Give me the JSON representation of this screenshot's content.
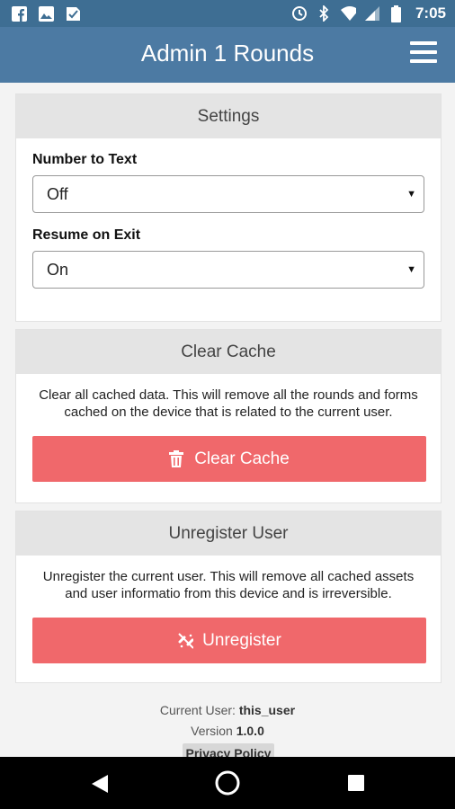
{
  "status_bar": {
    "time": "7:05",
    "icons": [
      "facebook-icon",
      "image-icon",
      "check-icon",
      "sync-icon",
      "bluetooth-icon",
      "wifi-icon",
      "signal-icon",
      "battery-icon"
    ]
  },
  "app_bar": {
    "title": "Admin 1 Rounds",
    "menu_icon": "hamburger-icon"
  },
  "settings": {
    "header": "Settings",
    "number_to_text": {
      "label": "Number to Text",
      "value": "Off"
    },
    "resume_on_exit": {
      "label": "Resume on Exit",
      "value": "On"
    }
  },
  "clear_cache": {
    "header": "Clear Cache",
    "description": "Clear all cached data. This will remove all the rounds and forms cached on the device that is related to the current user.",
    "button_label": "Clear Cache",
    "button_icon": "trash-icon"
  },
  "unregister": {
    "header": "Unregister User",
    "description": "Unregister the current user. This will remove all cached assets and user informatio from this device and is irreversible.",
    "button_label": "Unregister",
    "button_icon": "unlink-icon"
  },
  "footer": {
    "current_user_label": "Current User:",
    "current_user": "this_user",
    "version_label": "Version",
    "version": "1.0.0",
    "privacy_policy": "Privacy Policy"
  },
  "colors": {
    "status_bar": "#3e6e93",
    "app_bar": "#4c7aa3",
    "button": "#f0686b"
  }
}
